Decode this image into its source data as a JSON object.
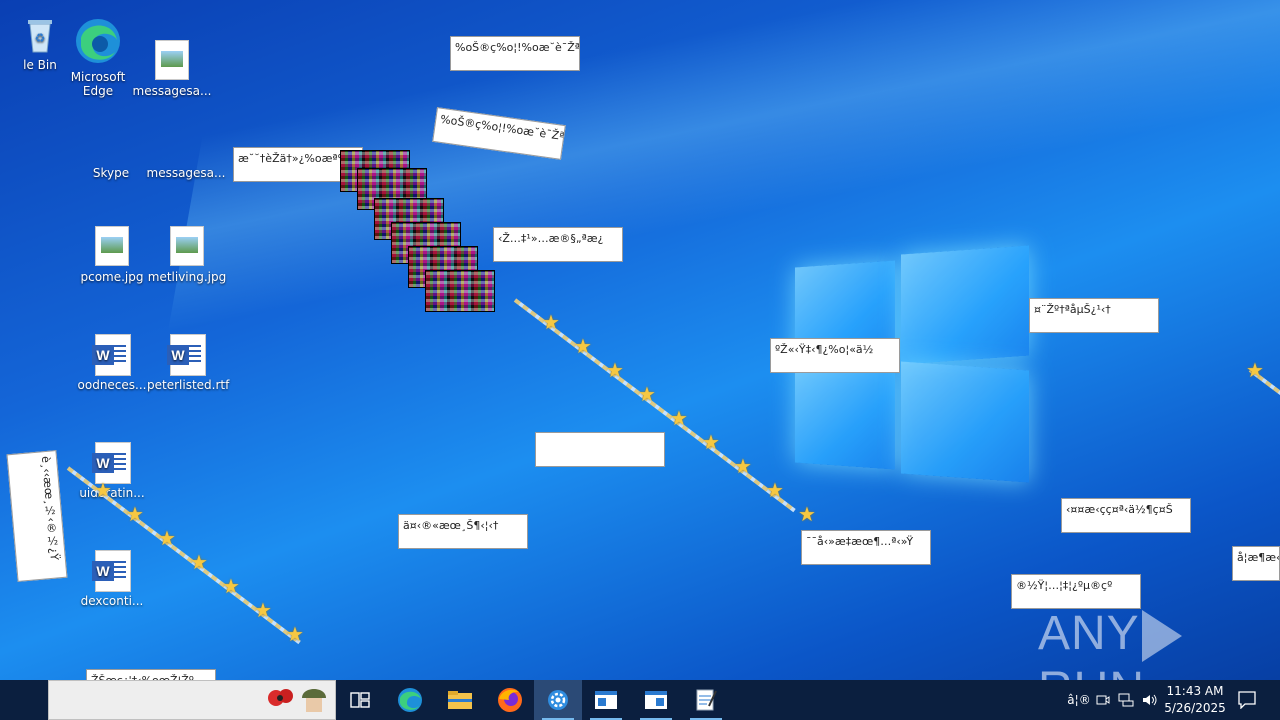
{
  "desktop": {
    "icons": [
      {
        "label": "le Bin",
        "kind": "recycle"
      },
      {
        "label": "Microsoft Edge",
        "kind": "edge"
      },
      {
        "label": "messagesa...",
        "kind": "image-file"
      },
      {
        "label": "Skype",
        "kind": "skype"
      },
      {
        "label": "messagesa...",
        "kind": "image-file"
      },
      {
        "label": "pcome.jpg",
        "kind": "image-file"
      },
      {
        "label": "metliving.jpg",
        "kind": "image-file"
      },
      {
        "label": "oodneces...",
        "kind": "word-file"
      },
      {
        "label": "peterlisted.rtf",
        "kind": "word-file"
      },
      {
        "label": "uideratin...",
        "kind": "word-file"
      },
      {
        "label": "dexconti...",
        "kind": "word-file"
      }
    ]
  },
  "garbled_windows": [
    "%oŠ®ç%o¦!%oæ˘è¯Žª",
    "%oŠ®ç%o¦!%oæ˘è¯Žª",
    "æ˘˘†èŽä†»¿%oæª%",
    "‹Ž…‡¹»…æ®§„ªæ¿",
    "¤¨Žº†ªåµŠ¿¹‹†",
    "ºŽ«‹Ÿ‡‹¶¿%o¦«ä½",
    "",
    "ä¤‹®«æœ¸Š¶‹¦‹†",
    "¯¯å‹»æ‡æœ¶…ª‹»Ÿ",
    "‹¤¤æ‹çç¤ª‹ä½¶ç¤Š",
    "®½Ÿ¦…¦‡¦¿ºµ®çº",
    "å¦æ¶æ«»",
    "ŽŠœç¿'‡‹%oœŽ¦Žº",
    "è¸‹‹æœ¸½‹®½¿Ÿ"
  ],
  "taskbar": {
    "search_text": "",
    "apps": [
      "task-view",
      "edge",
      "file-explorer",
      "firefox",
      "settings",
      "window-1",
      "window-2",
      "notepad"
    ],
    "tray_lang": "â¦®",
    "time": "11:43 AM",
    "date": "5/26/2025"
  },
  "watermark": {
    "left": "ANY",
    "right": "RUN"
  },
  "colors": {
    "taskbar": "#0b1f3f",
    "accent": "#76b9ed",
    "star": "#f6c842"
  }
}
